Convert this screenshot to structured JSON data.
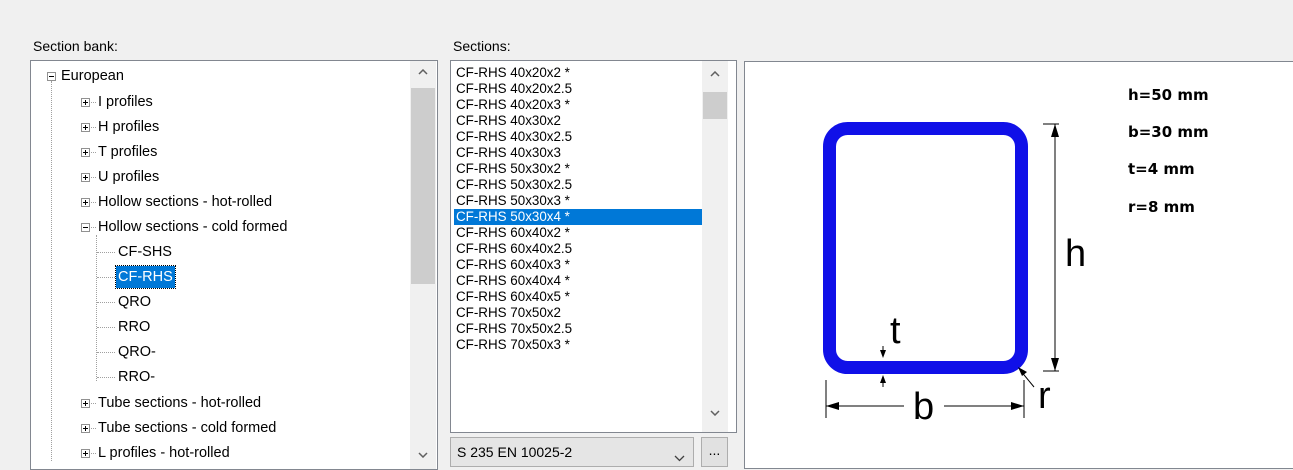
{
  "labels": {
    "section_bank": "Section bank:",
    "sections": "Sections:"
  },
  "tree": {
    "root": "European",
    "groups": [
      "I profiles",
      "H profiles",
      "T profiles",
      "U profiles",
      "Hollow sections - hot-rolled",
      "Hollow sections - cold formed"
    ],
    "cold_formed_children": [
      "CF-SHS",
      "CF-RHS",
      "QRO",
      "RRO",
      "QRO-",
      "RRO-"
    ],
    "after_groups": [
      "Tube sections - hot-rolled",
      "Tube sections - cold formed",
      "L profiles - hot-rolled"
    ],
    "selected": "CF-RHS"
  },
  "sections": {
    "items": [
      "CF-RHS 40x20x2 *",
      "CF-RHS 40x20x2.5",
      "CF-RHS 40x20x3 *",
      "CF-RHS 40x30x2",
      "CF-RHS 40x30x2.5",
      "CF-RHS 40x30x3",
      "CF-RHS 50x30x2 *",
      "CF-RHS 50x30x2.5",
      "CF-RHS 50x30x3 *",
      "CF-RHS 50x30x4 *",
      "CF-RHS 60x40x2 *",
      "CF-RHS 60x40x2.5",
      "CF-RHS 60x40x3 *",
      "CF-RHS 60x40x4 *",
      "CF-RHS 60x40x5 *",
      "CF-RHS 70x50x2",
      "CF-RHS 70x50x2.5",
      "CF-RHS 70x50x3 *"
    ],
    "selected_index": 9
  },
  "material": {
    "value": "S 235 EN 10025-2",
    "more_button": "..."
  },
  "dimensions": {
    "h": "h=50 mm",
    "b": "b=30 mm",
    "t": "t=4 mm",
    "r": "r=8 mm"
  },
  "drawing_labels": {
    "h": "h",
    "b": "b",
    "t": "t",
    "r": "r"
  },
  "colors": {
    "selection": "#0078d7",
    "section_profile": "#1010e8"
  }
}
